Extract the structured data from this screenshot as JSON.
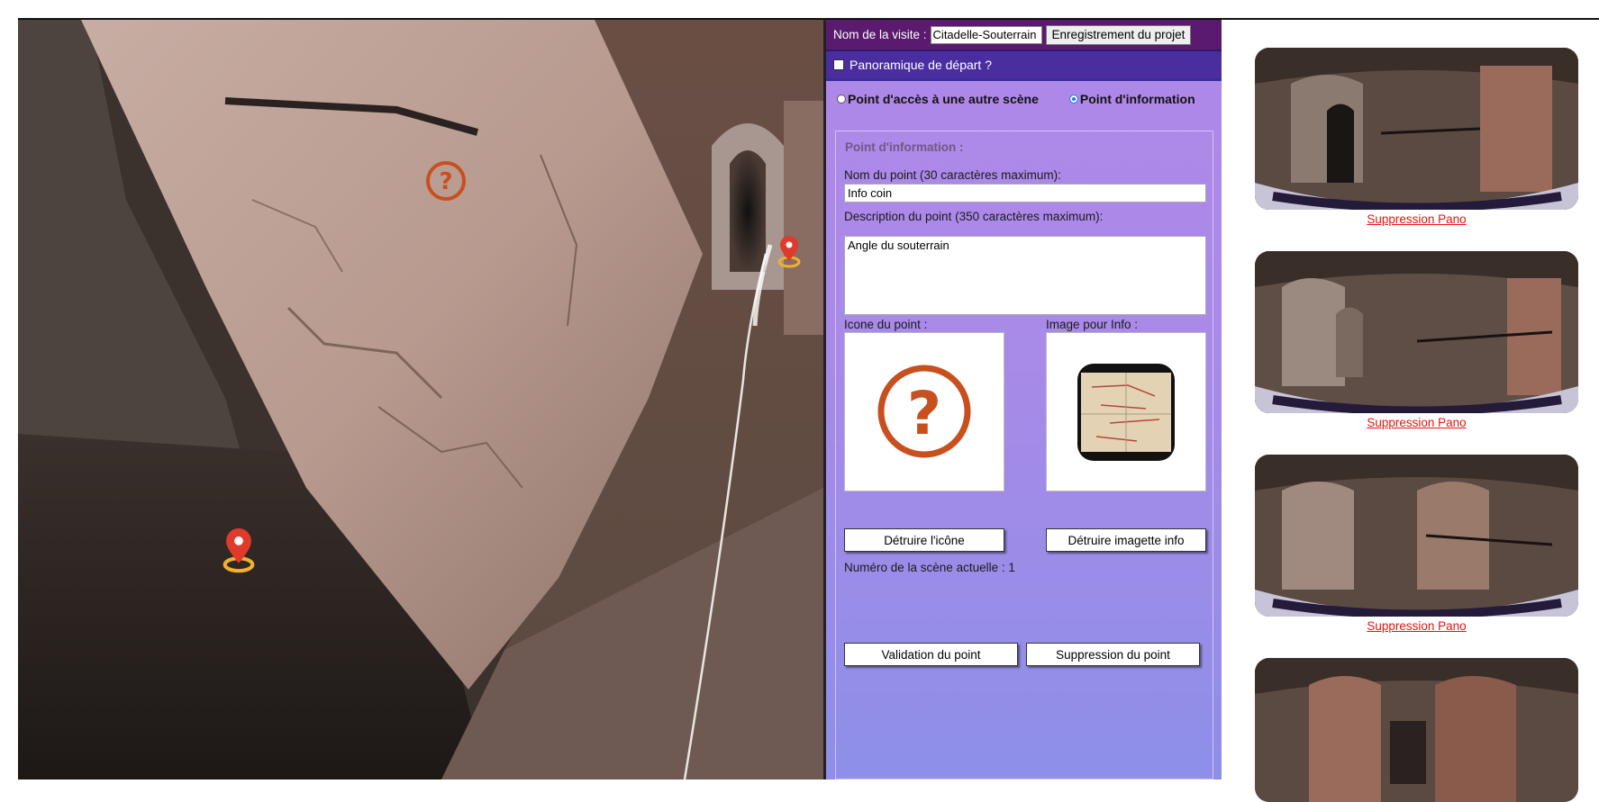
{
  "viewer": {
    "hotspots": [
      {
        "type": "info",
        "icon": "question-icon"
      },
      {
        "type": "access",
        "icon": "map-pin-icon"
      },
      {
        "type": "access",
        "icon": "map-pin-icon"
      }
    ]
  },
  "editor": {
    "visit_label": "Nom de la visite :",
    "visit_name": "Citadelle-Souterrain",
    "save_button": "Enregistrement du projet",
    "start_pano_label": "Panoramique de départ ?",
    "radio_access_label": "Point d'accès à une autre scène",
    "radio_info_label": "Point d'information",
    "radio_selected": "info",
    "info_legend": "Point d'information :",
    "name_label": "Nom du point (30 caractères maximum):",
    "name_value": "Info coin",
    "desc_label": "Description du point (350 caractères maximum):",
    "desc_value": "Angle du souterrain",
    "icon_label": "Icone du point :",
    "image_label": "Image pour Info :",
    "destroy_icon_button": "Détruire l'icône",
    "destroy_image_button": "Détruire imagette info",
    "scene_number_label": "Numéro de la scène actuelle :",
    "scene_number_value": "1",
    "validate_button": "Validation du point",
    "delete_button": "Suppression du point"
  },
  "thumbnails": {
    "delete_label": "Suppression Pano",
    "items": [
      {
        "has_delete": true
      },
      {
        "has_delete": true
      },
      {
        "has_delete": true
      },
      {
        "has_delete": false
      }
    ]
  },
  "colors": {
    "topbar": "#5a1a6e",
    "startbar": "#4a2ea0",
    "panel_gradient_top": "#b088e8",
    "panel_gradient_bottom": "#8d8fe8",
    "delete_link": "#e11111",
    "hotspot_orange": "#c8501e",
    "pin_red": "#e03a2a",
    "pin_ring": "#f0b030"
  }
}
